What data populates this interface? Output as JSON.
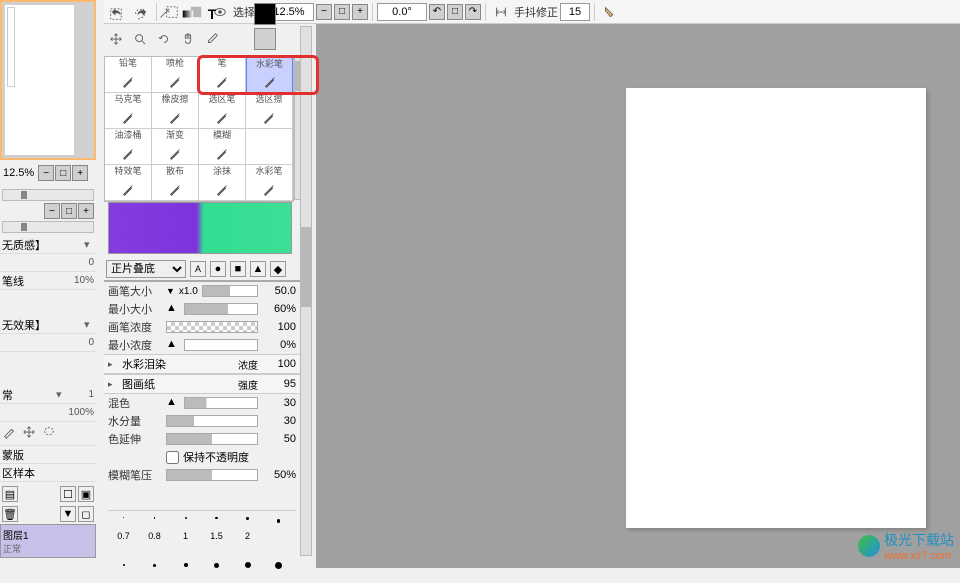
{
  "toolbar": {
    "select_label": "选择",
    "zoom_value": "12.5%",
    "rotation": "0.0°",
    "stabilizer_label": "手抖修正",
    "stabilizer_value": "15"
  },
  "thumbnail": {
    "zoom": "12.5%"
  },
  "left_props": {
    "texture_quality": "无质感】",
    "texture_quality_val": "0",
    "line": "笔线",
    "line_val": "10%",
    "effect": "无效果】",
    "effect_val": "0",
    "normal": "常",
    "normal_val": "1",
    "opacity_val": "100%",
    "mask": "蒙版",
    "sample": "区样本",
    "layer1": "图层1",
    "layer1_mode": "正常"
  },
  "brushes": [
    {
      "label": "铅笔",
      "icon": "pencil"
    },
    {
      "label": "喷枪",
      "icon": "airbrush"
    },
    {
      "label": "笔",
      "icon": "pen"
    },
    {
      "label": "水彩笔",
      "icon": "watercolor",
      "selected": true
    },
    {
      "label": "马克笔",
      "icon": "marker"
    },
    {
      "label": "橡皮擦",
      "icon": "eraser"
    },
    {
      "label": "选区笔",
      "icon": "selpen"
    },
    {
      "label": "选区擦",
      "icon": "seleraser"
    },
    {
      "label": "油漆桶",
      "icon": "bucket"
    },
    {
      "label": "渐变",
      "icon": "gradient"
    },
    {
      "label": "模糊",
      "icon": "blur"
    },
    {
      "label": "",
      "icon": ""
    },
    {
      "label": "特效笔",
      "icon": "fx"
    },
    {
      "label": "散布",
      "icon": "scatter"
    },
    {
      "label": "涂抹",
      "icon": "smudge"
    },
    {
      "label": "水彩笔",
      "icon": "watercolor2"
    }
  ],
  "blend": {
    "mode": "正片叠底"
  },
  "settings": {
    "size_label": "画笔大小",
    "size_mult": "x1.0",
    "size_val": "50.0",
    "min_size_label": "最小大小",
    "min_size_val": "60%",
    "density_label": "画笔浓度",
    "density_val": "100",
    "min_density_label": "最小浓度",
    "min_density_val": "0%",
    "bleed_label": "水彩泪染",
    "bleed_strength_label": "浓度",
    "bleed_val": "100",
    "paper_label": "图画纸",
    "paper_strength_label": "强度",
    "paper_val": "95",
    "mix_label": "混色",
    "mix_val": "30",
    "water_label": "水分量",
    "water_val": "30",
    "spread_label": "色延伸",
    "spread_val": "50",
    "keep_opacity": "保持不透明度",
    "blur_pressure_label": "模糊笔压",
    "blur_pressure_val": "50%"
  },
  "sizes": [
    "0.7",
    "0.8",
    "1",
    "1.5",
    "2",
    "",
    "",
    "",
    "",
    "",
    "",
    ""
  ],
  "watermark": {
    "text": "极光下载站",
    "url": "www.xz7.com"
  }
}
